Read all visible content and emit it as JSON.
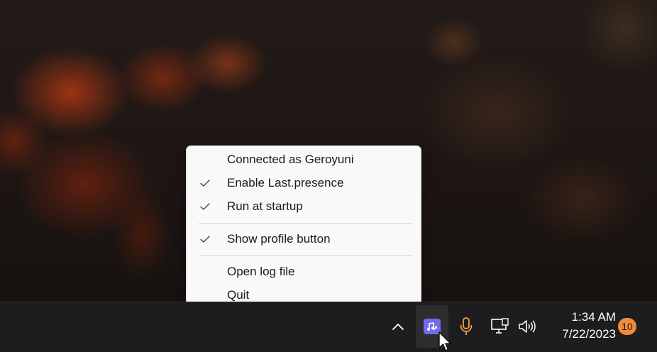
{
  "menu": {
    "items": [
      {
        "label": "Connected as Geroyuni",
        "checked": false
      },
      {
        "label": "Enable Last.presence",
        "checked": true
      },
      {
        "label": "Run at startup",
        "checked": true
      },
      {
        "label": "Show profile button",
        "checked": true
      },
      {
        "label": "Open log file",
        "checked": false
      },
      {
        "label": "Quit",
        "checked": false
      }
    ]
  },
  "taskbar": {
    "time": "1:34 AM",
    "date": "7/22/2023",
    "notification_count": "10",
    "icons": [
      "chevron-up-icon",
      "lastfm-app-icon",
      "microphone-icon",
      "network-icon",
      "volume-icon"
    ]
  },
  "colors": {
    "app_icon": "#6f6cf0",
    "microphone": "#f0a04b",
    "badge": "#f08a3c",
    "menu_bg": "#f9f9f9",
    "taskbar_bg": "#1d1d1f"
  }
}
